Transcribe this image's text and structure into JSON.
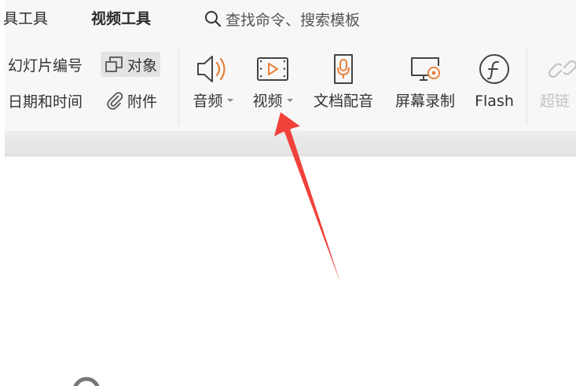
{
  "tabs": {
    "partial_tool": "具工具",
    "video_tools": "视频工具"
  },
  "search": {
    "placeholder": "查找命令、搜索模板"
  },
  "insert_group": {
    "slide_number": "幻灯片编号",
    "object": "对象",
    "date_time": "日期和时间",
    "attachment": "附件"
  },
  "media_group": {
    "audio": "音频",
    "video": "视频",
    "doc_dubbing": "文档配音",
    "screen_record": "屏幕录制",
    "flash": "Flash",
    "hyperlink": "超链"
  },
  "colors": {
    "accent_orange": "#e8813a",
    "arrow_red": "#f0413a",
    "icon_gray": "#555555"
  }
}
